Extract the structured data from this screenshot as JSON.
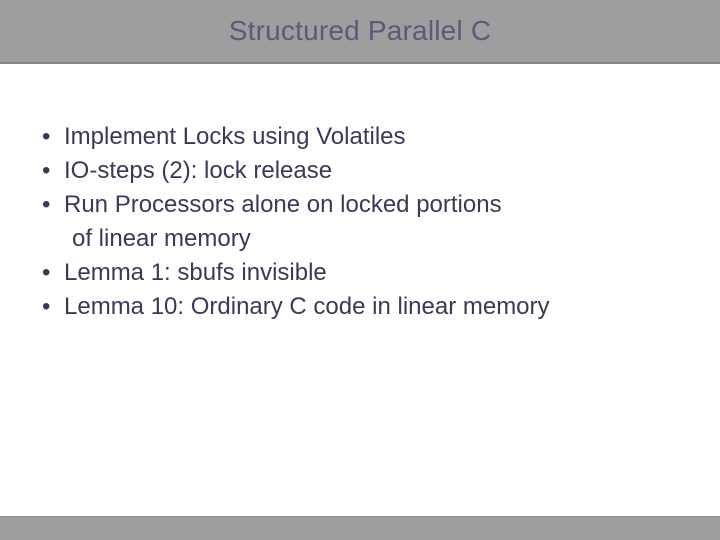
{
  "slide": {
    "title": "Structured Parallel C",
    "bullets": [
      {
        "line1": "Implement Locks using Volatiles"
      },
      {
        "line1": "IO-steps (2): lock release"
      },
      {
        "line1": "Run Processors alone on locked portions",
        "line2": "of linear memory"
      },
      {
        "line1": "Lemma 1: sbufs invisible"
      },
      {
        "line1": "Lemma 10: Ordinary C code in linear memory"
      }
    ]
  }
}
